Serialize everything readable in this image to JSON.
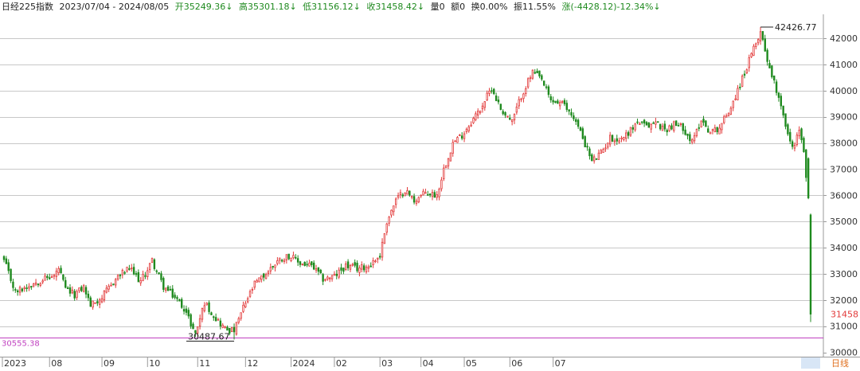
{
  "header": {
    "name": "日经225指数",
    "range": "2023/07/04 - 2024/08/05",
    "open": "开35249.36↓",
    "high": "高35301.18↓",
    "low": "低31156.12↓",
    "close": "收31458.42↓",
    "volume": "量0",
    "amount": "额0",
    "turnover": "换0.00%",
    "amplitude": "振11.55%",
    "change": "涨(-4428.12)-12.34%↓"
  },
  "colors": {
    "up": "#e23a3a",
    "down": "#1f8a1f",
    "grid": "#c8c8c8",
    "reference_line": "#c040c0",
    "last_price": "#e23a3a"
  },
  "chart_data": {
    "type": "candlestick",
    "ylim": [
      30000,
      42500
    ],
    "y_ticks": [
      30000,
      31000,
      32000,
      33000,
      34000,
      35000,
      36000,
      37000,
      38000,
      39000,
      40000,
      41000,
      42000
    ],
    "x_tick_labels": [
      "2023",
      "08",
      "09",
      "10",
      "11",
      "12",
      "2024",
      "02",
      "03",
      "04",
      "05",
      "06",
      "07",
      "08"
    ],
    "max_annotation": "42426.77",
    "min_annotation": "30487.67",
    "reference_line": {
      "value": 30555.38,
      "label": "30555.38"
    },
    "last_price_label": "31458",
    "period_label": "日线",
    "anchors": [
      {
        "i": 0,
        "p": 33500
      },
      {
        "i": 5,
        "p": 32300
      },
      {
        "i": 12,
        "p": 32600
      },
      {
        "i": 17,
        "p": 32800
      },
      {
        "i": 22,
        "p": 32900
      },
      {
        "i": 24,
        "p": 33200
      },
      {
        "i": 27,
        "p": 32400
      },
      {
        "i": 31,
        "p": 32200
      },
      {
        "i": 35,
        "p": 32500
      },
      {
        "i": 38,
        "p": 31800
      },
      {
        "i": 43,
        "p": 32100
      },
      {
        "i": 50,
        "p": 32900
      },
      {
        "i": 55,
        "p": 33200
      },
      {
        "i": 60,
        "p": 32700
      },
      {
        "i": 65,
        "p": 33500
      },
      {
        "i": 70,
        "p": 32500
      },
      {
        "i": 75,
        "p": 32100
      },
      {
        "i": 79,
        "p": 31700
      },
      {
        "i": 84,
        "p": 30700
      },
      {
        "i": 88,
        "p": 31900
      },
      {
        "i": 93,
        "p": 31300
      },
      {
        "i": 97,
        "p": 30900
      },
      {
        "i": 101,
        "p": 30800
      },
      {
        "i": 105,
        "p": 31700
      },
      {
        "i": 110,
        "p": 32600
      },
      {
        "i": 115,
        "p": 33000
      },
      {
        "i": 120,
        "p": 33500
      },
      {
        "i": 125,
        "p": 33700
      },
      {
        "i": 130,
        "p": 33400
      },
      {
        "i": 135,
        "p": 33300
      },
      {
        "i": 140,
        "p": 32800
      },
      {
        "i": 145,
        "p": 32900
      },
      {
        "i": 150,
        "p": 33300
      },
      {
        "i": 155,
        "p": 33200
      },
      {
        "i": 160,
        "p": 33300
      },
      {
        "i": 165,
        "p": 33700
      },
      {
        "i": 168,
        "p": 35000
      },
      {
        "i": 172,
        "p": 35800
      },
      {
        "i": 176,
        "p": 36200
      },
      {
        "i": 180,
        "p": 35800
      },
      {
        "i": 185,
        "p": 36100
      },
      {
        "i": 190,
        "p": 36000
      },
      {
        "i": 193,
        "p": 37000
      },
      {
        "i": 197,
        "p": 38000
      },
      {
        "i": 201,
        "p": 38300
      },
      {
        "i": 205,
        "p": 38800
      },
      {
        "i": 209,
        "p": 39300
      },
      {
        "i": 214,
        "p": 40100
      },
      {
        "i": 218,
        "p": 39300
      },
      {
        "i": 223,
        "p": 38800
      },
      {
        "i": 227,
        "p": 39800
      },
      {
        "i": 232,
        "p": 40700
      },
      {
        "i": 236,
        "p": 40400
      },
      {
        "i": 240,
        "p": 39600
      },
      {
        "i": 245,
        "p": 39500
      },
      {
        "i": 250,
        "p": 39000
      },
      {
        "i": 254,
        "p": 38200
      },
      {
        "i": 258,
        "p": 37300
      },
      {
        "i": 262,
        "p": 37600
      },
      {
        "i": 266,
        "p": 38200
      },
      {
        "i": 270,
        "p": 38100
      },
      {
        "i": 274,
        "p": 38400
      },
      {
        "i": 278,
        "p": 38800
      },
      {
        "i": 282,
        "p": 38600
      },
      {
        "i": 286,
        "p": 38800
      },
      {
        "i": 290,
        "p": 38500
      },
      {
        "i": 294,
        "p": 38700
      },
      {
        "i": 298,
        "p": 38600
      },
      {
        "i": 302,
        "p": 38000
      },
      {
        "i": 306,
        "p": 38900
      },
      {
        "i": 310,
        "p": 38400
      },
      {
        "i": 314,
        "p": 38600
      },
      {
        "i": 318,
        "p": 39200
      },
      {
        "i": 322,
        "p": 40000
      },
      {
        "i": 326,
        "p": 40900
      },
      {
        "i": 330,
        "p": 41800
      },
      {
        "i": 332,
        "p": 42300
      },
      {
        "i": 335,
        "p": 41200
      },
      {
        "i": 338,
        "p": 40300
      },
      {
        "i": 341,
        "p": 39500
      },
      {
        "i": 344,
        "p": 38300
      },
      {
        "i": 346,
        "p": 37800
      },
      {
        "i": 349,
        "p": 38500
      },
      {
        "i": 351,
        "p": 37600
      },
      {
        "i": 353,
        "p": 35900
      },
      {
        "i": 354,
        "p": 31458
      }
    ],
    "last_candles": [
      {
        "o": 37400,
        "h": 37450,
        "l": 35850,
        "c": 35900
      },
      {
        "o": 35249.36,
        "h": 35301.18,
        "l": 31156.12,
        "c": 31458.42
      }
    ]
  }
}
